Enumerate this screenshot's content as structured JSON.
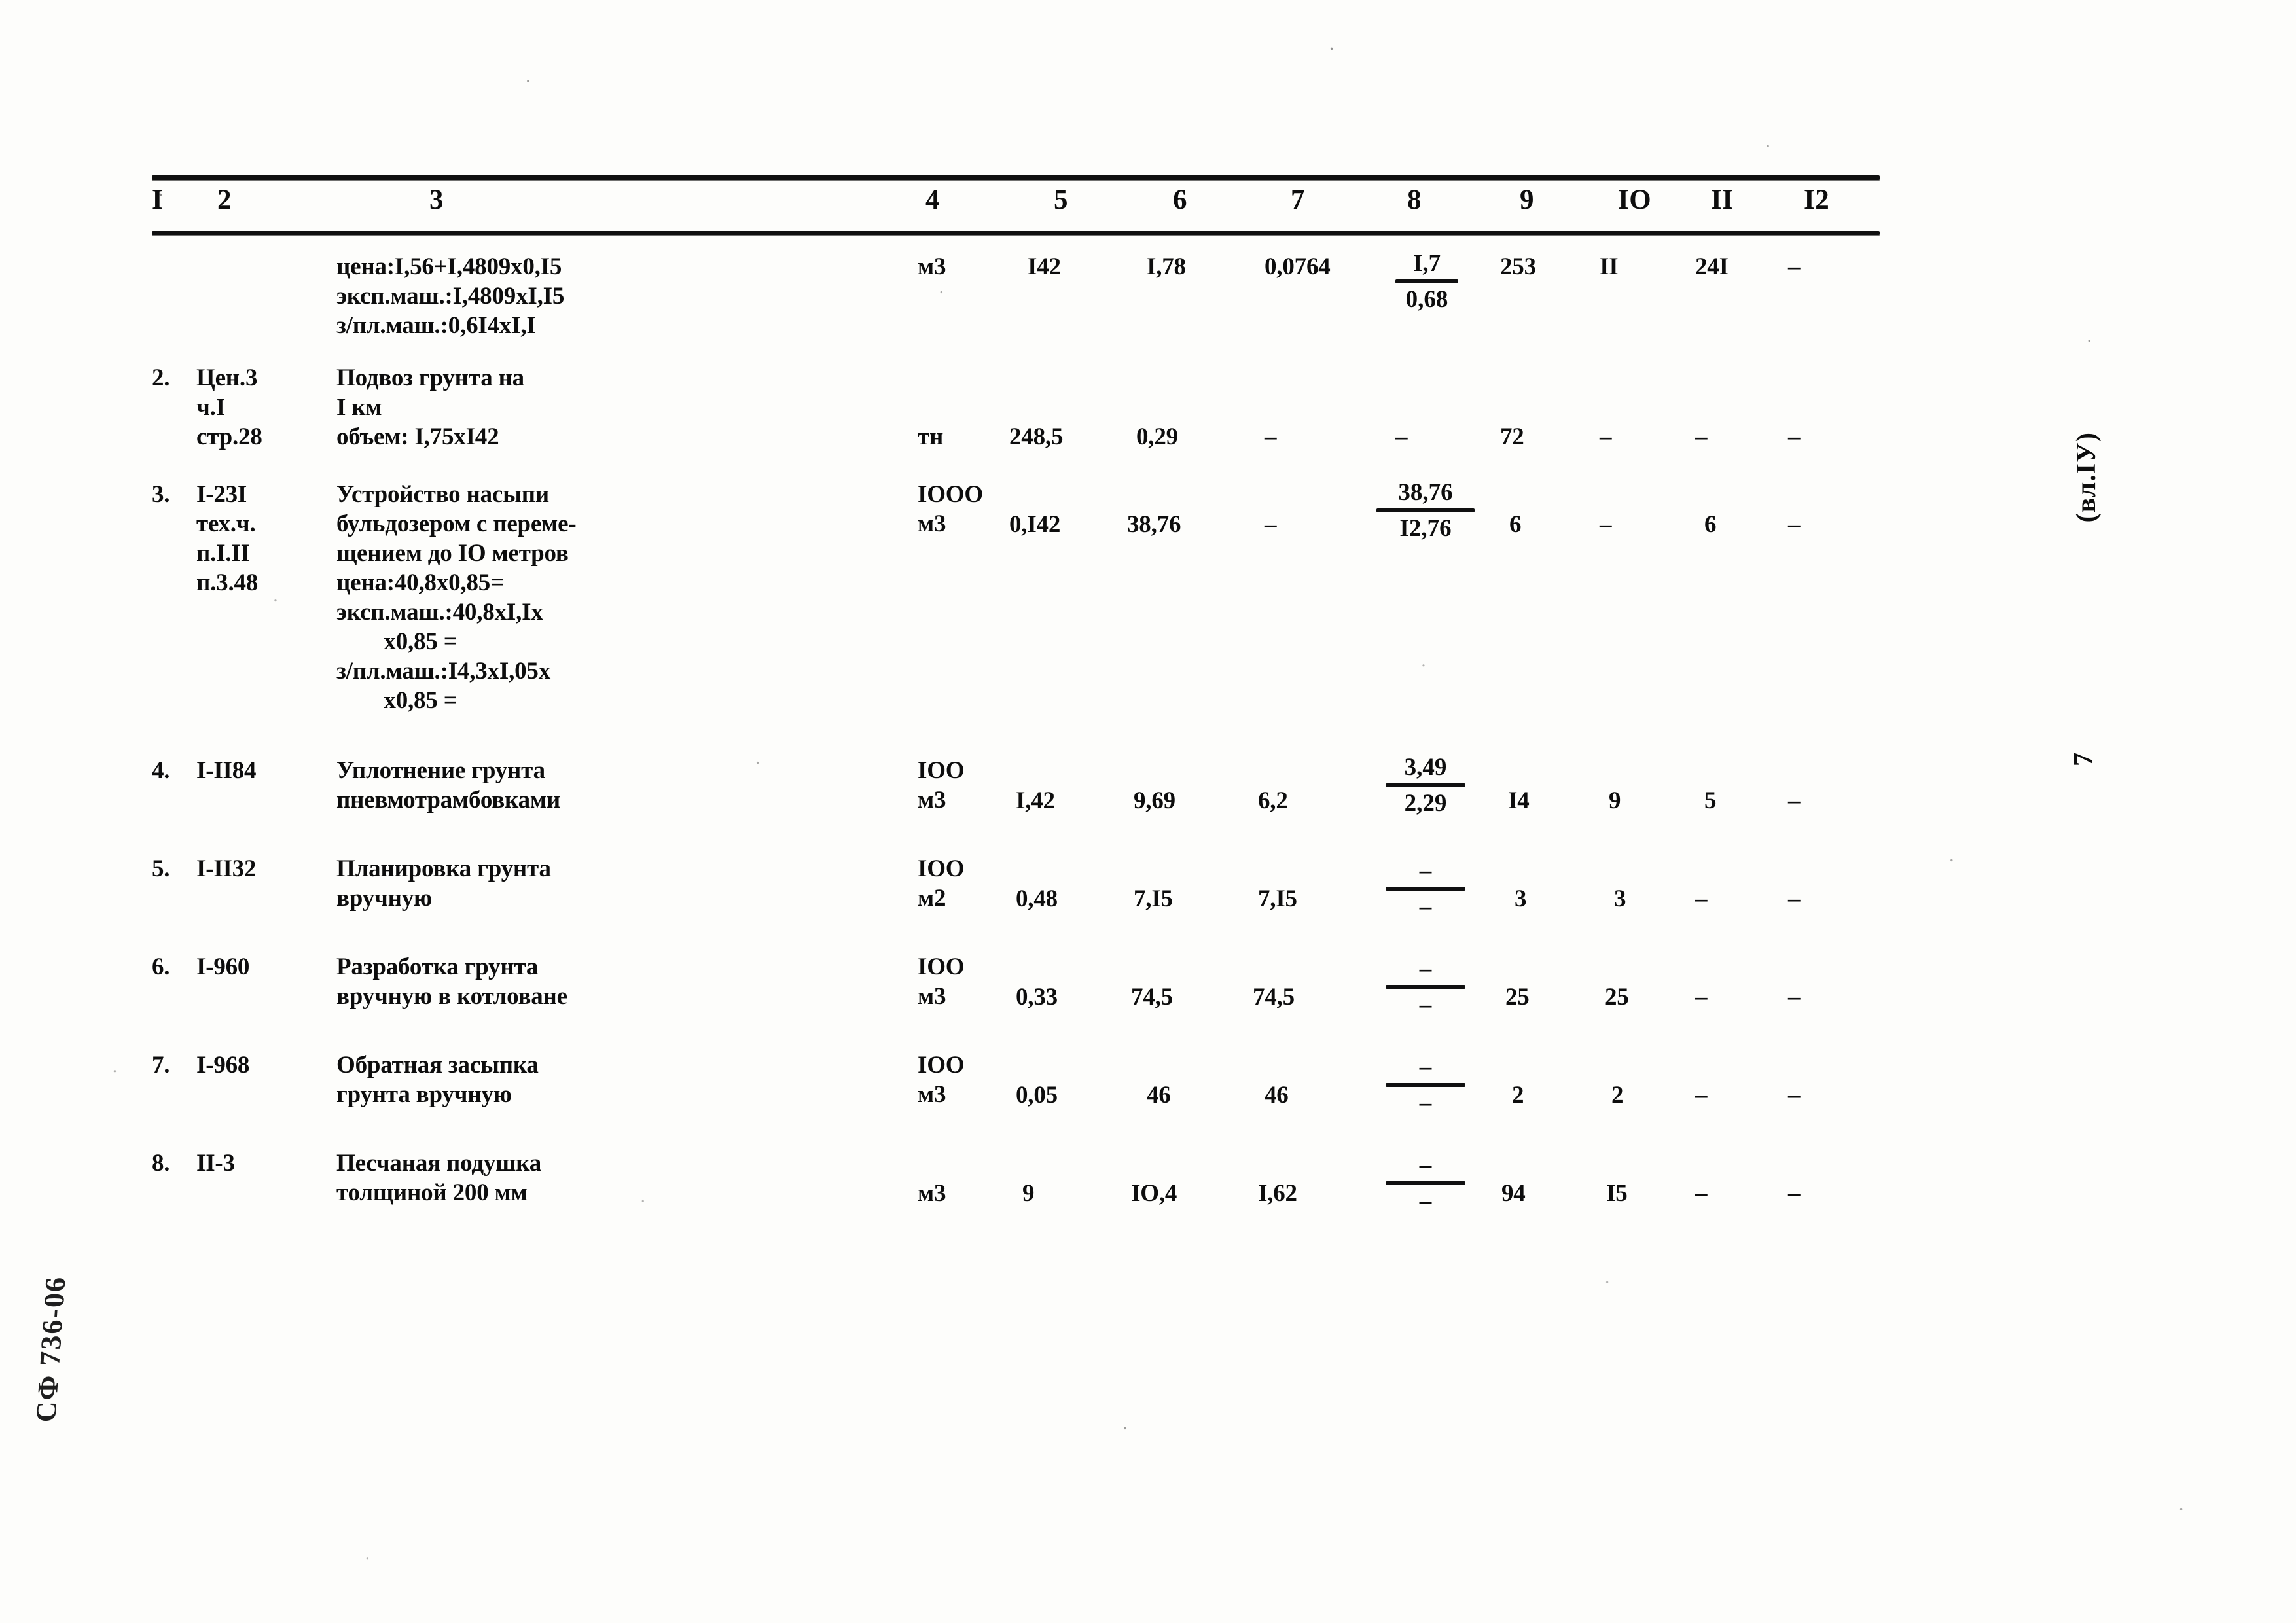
{
  "document": {
    "side_note": "(вл.IУ)",
    "page_number": "7",
    "archive_stamp": "СФ 736-06"
  },
  "table": {
    "column_headers": [
      "I",
      "2",
      "3",
      "4",
      "5",
      "6",
      "7",
      "8",
      "9",
      "IO",
      "II",
      "I2"
    ],
    "rows": [
      {
        "index": "",
        "code": "",
        "description": "цена:I,56+I,4809х0,I5\nэксп.маш.:I,4809хI,I5\nз/пл.маш.:0,6I4хI,I",
        "unit": "м3",
        "c5": "I42",
        "c6": "I,78",
        "c7": "0,0764",
        "c8_num": "I,7",
        "c8_den": "0,68",
        "c9": "253",
        "c10": "II",
        "c11": "24I",
        "c12": "–"
      },
      {
        "index": "2.",
        "code": "Цен.3\nч.I\nстр.28",
        "description": "Подвоз грунта на\nI км\nобъем: I,75хI42",
        "unit": "тн",
        "c5": "248,5",
        "c6": "0,29",
        "c7": "–",
        "c8_num": "",
        "c8_den": "",
        "c8_plain": "–",
        "c9": "72",
        "c10": "–",
        "c11": "–",
        "c12": "–"
      },
      {
        "index": "3.",
        "code": "I-23I\nтех.ч.\nп.I.II\nп.3.48",
        "description": "Устройство насыпи\nбульдозером с переме-\nщением до IO метров\nцена:40,8х0,85=\nэксп.маш.:40,8хI,Iх\n        х0,85 =\nз/пл.маш.:I4,3хI,05х\n        х0,85 =",
        "unit": "IOOO\nм3",
        "c5": "0,I42",
        "c6": "38,76",
        "c7": "–",
        "c8_num": "38,76",
        "c8_den": "I2,76",
        "c9": "6",
        "c10": "–",
        "c11": "6",
        "c12": "–"
      },
      {
        "index": "4.",
        "code": "I-II84",
        "description": "Уплотнение грунта\nпневмотрамбовками",
        "unit": "IOO\nм3",
        "c5": "I,42",
        "c6": "9,69",
        "c7": "6,2",
        "c8_num": "3,49",
        "c8_den": "2,29",
        "c9": "I4",
        "c10": "9",
        "c11": "5",
        "c12": "–"
      },
      {
        "index": "5.",
        "code": "I-II32",
        "description": "Планировка грунта\nвручную",
        "unit": "IOO\nм2",
        "c5": "0,48",
        "c6": "7,I5",
        "c7": "7,I5",
        "c8_num": "–",
        "c8_den": "–",
        "c9": "3",
        "c10": "3",
        "c11": "–",
        "c12": "–"
      },
      {
        "index": "6.",
        "code": "I-960",
        "description": "Разработка грунта\nвручную в котловане",
        "unit": "IOO\nм3",
        "c5": "0,33",
        "c6": "74,5",
        "c7": "74,5",
        "c8_num": "–",
        "c8_den": "–",
        "c9": "25",
        "c10": "25",
        "c11": "–",
        "c12": "–"
      },
      {
        "index": "7.",
        "code": "I-968",
        "description": "Обратная засыпка\nгрунта вручную",
        "unit": "IOO\nм3",
        "c5": "0,05",
        "c6": "46",
        "c7": "46",
        "c8_num": "–",
        "c8_den": "–",
        "c9": "2",
        "c10": "2",
        "c11": "–",
        "c12": "–"
      },
      {
        "index": "8.",
        "code": "II-3",
        "description": "Песчаная подушка\nтолщиной 200 мм",
        "unit": "м3",
        "c5": "9",
        "c6": "IO,4",
        "c7": "I,62",
        "c8_num": "–",
        "c8_den": "–",
        "c9": "94",
        "c10": "I5",
        "c11": "–",
        "c12": "–"
      }
    ]
  }
}
